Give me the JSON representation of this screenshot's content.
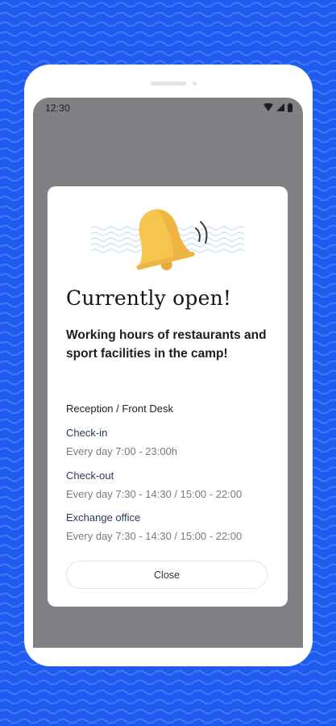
{
  "status_bar": {
    "time": "12:30",
    "icons": [
      "wifi-icon",
      "signal-icon",
      "battery-icon"
    ]
  },
  "dialog": {
    "title": "Currently open!",
    "subtitle": "Working hours of restaurants and sport facilities in the camp!",
    "section_title": "Reception / Front Desk",
    "items": [
      {
        "label": "Check-in",
        "value": "Every day 7:00 - 23:00h"
      },
      {
        "label": "Check-out",
        "value": "Every day 7:30 - 14:30 / 15:00 - 22:00"
      },
      {
        "label": "Exchange office",
        "value": "Every day 7:30 - 14:30 / 15:00 - 22:00"
      }
    ],
    "close_label": "Close",
    "illustration": "ringing-bell-icon"
  },
  "colors": {
    "background": "#1f5bf0",
    "scrim": "#7f8184",
    "bell": "#f7c44d",
    "bell_shadow": "#eaa93a",
    "wave": "#cfe4f6",
    "label_text": "#2a3b55",
    "muted_text": "#777b80"
  }
}
